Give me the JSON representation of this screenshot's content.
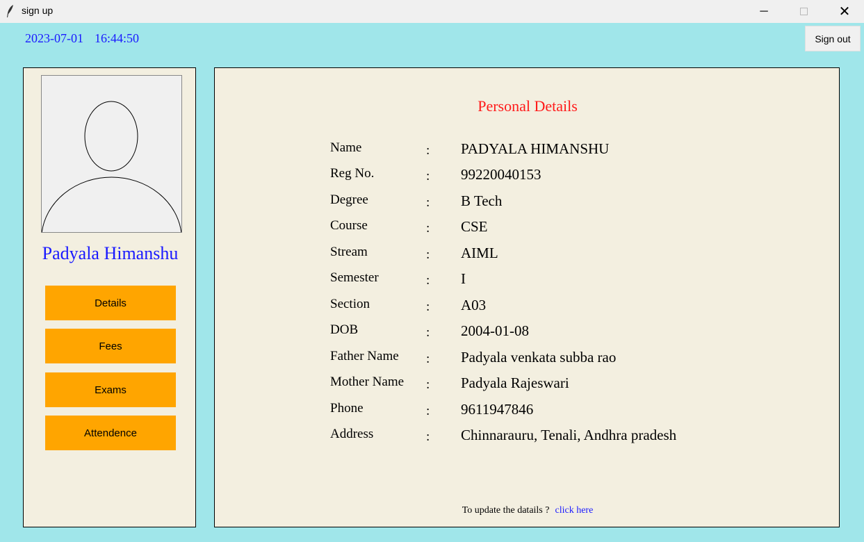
{
  "window": {
    "title": "sign up",
    "icon": "feather-icon"
  },
  "header": {
    "date": "2023-07-01",
    "time": "16:44:50",
    "signout_label": "Sign out"
  },
  "profile": {
    "name": "Padyala Himanshu",
    "avatar_icon": "user-silhouette-icon"
  },
  "nav": {
    "items": [
      {
        "label": "Details"
      },
      {
        "label": "Fees"
      },
      {
        "label": "Exams"
      },
      {
        "label": "Attendence"
      }
    ]
  },
  "details": {
    "title": "Personal Details",
    "separator": ":",
    "rows": [
      {
        "label": "Name",
        "value": "PADYALA HIMANSHU"
      },
      {
        "label": "Reg No.",
        "value": "99220040153"
      },
      {
        "label": "Degree",
        "value": "B Tech"
      },
      {
        "label": "Course",
        "value": "CSE"
      },
      {
        "label": "Stream",
        "value": "AIML"
      },
      {
        "label": "Semester",
        "value": "I"
      },
      {
        "label": "Section",
        "value": "A03"
      },
      {
        "label": "DOB",
        "value": "2004-01-08"
      },
      {
        "label": "Father Name",
        "value": "Padyala venkata subba rao"
      },
      {
        "label": "Mother Name",
        "value": "Padyala Rajeswari"
      },
      {
        "label": "Phone",
        "value": "9611947846"
      },
      {
        "label": "Address",
        "value": "Chinnarauru, Tenali, Andhra pradesh"
      }
    ],
    "update_prompt": "To update the datails ?",
    "update_link": "click here"
  },
  "colors": {
    "background": "#a0e6ea",
    "panel": "#f3efe0",
    "accent_button": "#ffa500",
    "title": "#ff1a1a",
    "link": "#1a1aff"
  }
}
